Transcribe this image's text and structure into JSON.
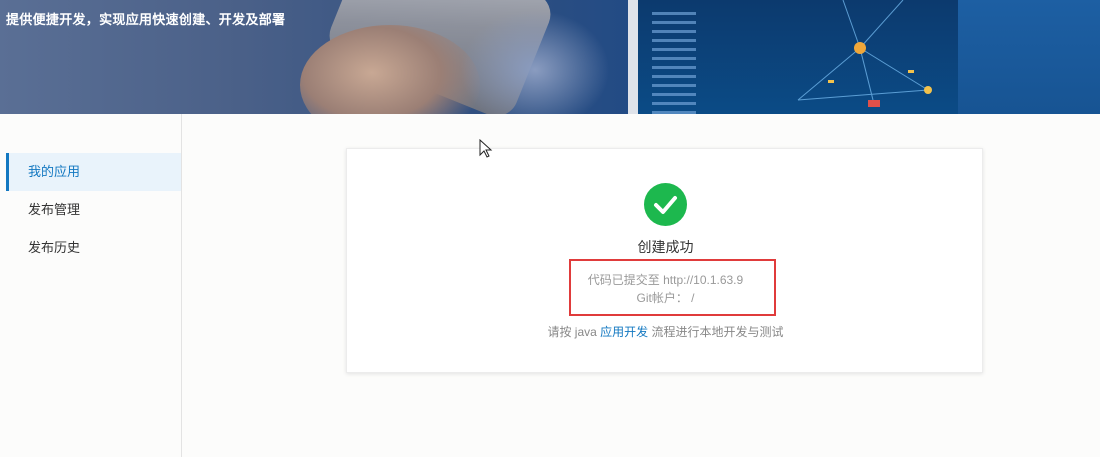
{
  "banner": {
    "tagline": "提供便捷开发，实现应用快速创建、开发及部署"
  },
  "sidebar": {
    "items": [
      {
        "label": "我的应用",
        "active": true
      },
      {
        "label": "发布管理",
        "active": false
      },
      {
        "label": "发布历史",
        "active": false
      }
    ]
  },
  "result": {
    "icon": "check-circle-icon",
    "title": "创建成功",
    "code_line": "代码已提交至 http://10.1.63.9",
    "git_line": "Git帐户：  /",
    "hint_prefix": "请按 java ",
    "hint_link": "应用开发",
    "hint_suffix": " 流程进行本地开发与测试"
  },
  "colors": {
    "accent": "#1378c1",
    "success": "#1db84e",
    "highlight_box": "#e03b3b"
  }
}
